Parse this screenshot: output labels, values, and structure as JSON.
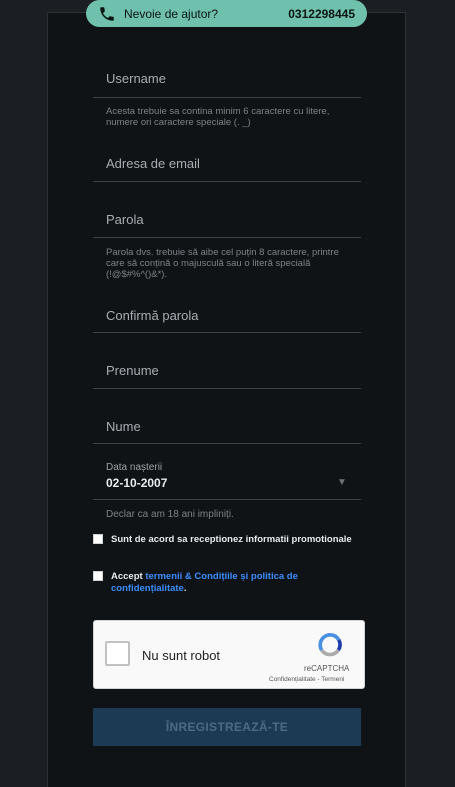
{
  "help": {
    "text": "Nevoie de ajutor?",
    "phone": "0312298445"
  },
  "form": {
    "username_label": "Username",
    "username_hint": "Acesta trebuie sa contina minim 6 caractere cu litere, numere ori caractere speciale (. _)",
    "email_label": "Adresa de email",
    "password_label": "Parola",
    "password_hint": "Parola dvs. trebuie să aibe cel puțin 8 caractere, printre care să conțină o majusculă sau o literă specială (!@$#%^()&*).",
    "confirm_label": "Confirmă parola",
    "firstname_label": "Prenume",
    "lastname_label": "Nume",
    "birth_label": "Data nașterii",
    "birth_value": "02-10-2007",
    "age_note": "Declar ca am 18 ani impliniți.",
    "promo_label": "Sunt de acord sa receptionez informatii promotionale",
    "accept_prefix": "Accept ",
    "accept_link": "termenii & Condițiile și politica de confidențialitate",
    "accept_suffix": ".",
    "submit_label": "ÎNREGISTREAZĂ-TE"
  },
  "recaptcha": {
    "label": "Nu sunt robot",
    "brand": "reCAPTCHA",
    "links": "Confidențialitate - Termeni"
  },
  "colors": {
    "help_bg": "#6fc0ac",
    "submit_bg": "#1d3a55",
    "link": "#3b8dff"
  }
}
